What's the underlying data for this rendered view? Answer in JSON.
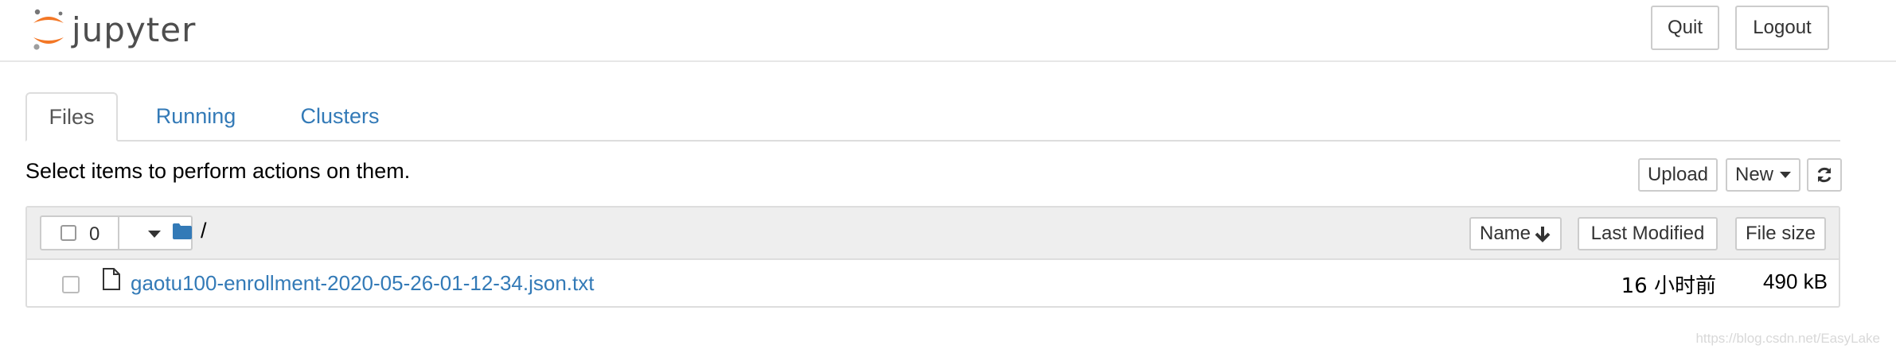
{
  "header": {
    "logo_text": "jupyter",
    "quit_label": "Quit",
    "logout_label": "Logout"
  },
  "tabs": [
    {
      "label": "Files",
      "active": true
    },
    {
      "label": "Running",
      "active": false
    },
    {
      "label": "Clusters",
      "active": false
    }
  ],
  "toolbar": {
    "hint": "Select items to perform actions on them.",
    "upload_label": "Upload",
    "new_label": "New",
    "refresh_icon": "refresh-icon"
  },
  "list_header": {
    "selected_count": "0",
    "breadcrumb": "/",
    "sort_name_label": "Name",
    "sort_modified_label": "Last Modified",
    "sort_size_label": "File size"
  },
  "files": [
    {
      "name": "gaotu100-enrollment-2020-05-26-01-12-34.json.txt",
      "modified": "16 小时前",
      "size": "490 kB",
      "icon": "file-icon"
    }
  ],
  "watermark": "https://blog.csdn.net/EasyLake",
  "colors": {
    "link": "#337ab7",
    "logo_orange": "#f37726",
    "folder": "#337ab7",
    "border": "#cccccc",
    "header_bg": "#eeeeee"
  }
}
